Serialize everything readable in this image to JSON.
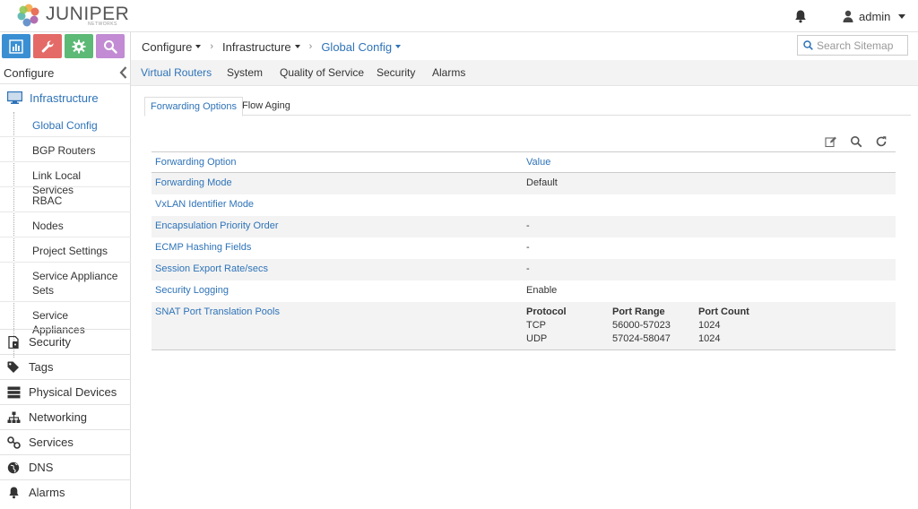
{
  "header": {
    "logo_text": "JUNIPER",
    "logo_sub": "NETWORKS",
    "user_name": "admin"
  },
  "sidebar": {
    "title": "Configure",
    "mode_tabs": [
      {
        "name": "monitor",
        "color": "#3a8fd3",
        "icon": "bar-chart-icon"
      },
      {
        "name": "configure",
        "color": "#e46a67",
        "icon": "wrench-icon"
      },
      {
        "name": "settings",
        "color": "#5cb976",
        "icon": "gear-icon"
      },
      {
        "name": "query",
        "color": "#c28bd3",
        "icon": "search-icon"
      }
    ],
    "infrastructure": {
      "label": "Infrastructure",
      "icon": "monitor-icon"
    },
    "sub_items": [
      {
        "label": "Global Config"
      },
      {
        "label": "BGP Routers"
      },
      {
        "label": "Link Local Services"
      },
      {
        "label": "RBAC"
      },
      {
        "label": "Nodes"
      },
      {
        "label": "Project Settings"
      },
      {
        "label": "Service Appliance Sets"
      },
      {
        "label": "Service Appliances"
      }
    ],
    "nav_items": [
      {
        "label": "Security",
        "icon": "security-doc-icon"
      },
      {
        "label": "Tags",
        "icon": "tags-icon"
      },
      {
        "label": "Physical Devices",
        "icon": "server-icon"
      },
      {
        "label": "Networking",
        "icon": "sitemap-icon"
      },
      {
        "label": "Services",
        "icon": "services-icon"
      },
      {
        "label": "DNS",
        "icon": "globe-icon"
      },
      {
        "label": "Alarms",
        "icon": "bell-icon"
      }
    ]
  },
  "breadcrumb": [
    {
      "label": "Configure"
    },
    {
      "label": "Infrastructure"
    },
    {
      "label": "Global Config"
    }
  ],
  "search": {
    "placeholder": "Search Sitemap"
  },
  "tabs": [
    {
      "label": "Virtual Routers"
    },
    {
      "label": "System"
    },
    {
      "label": "Quality of Service"
    },
    {
      "label": "Security"
    },
    {
      "label": "Alarms"
    }
  ],
  "subtabs": [
    {
      "label": "Forwarding Options"
    },
    {
      "label": "Flow Aging"
    }
  ],
  "grid": {
    "headers": {
      "option": "Forwarding Option",
      "value": "Value"
    },
    "rows": [
      {
        "option": "Forwarding Mode",
        "value": "Default"
      },
      {
        "option": "VxLAN Identifier Mode",
        "value": ""
      },
      {
        "option": "Encapsulation Priority Order",
        "value": "-"
      },
      {
        "option": "ECMP Hashing Fields",
        "value": "-"
      },
      {
        "option": "Session Export Rate/secs",
        "value": "-"
      },
      {
        "option": "Security Logging",
        "value": "Enable"
      }
    ],
    "snat": {
      "option": "SNAT Port Translation Pools",
      "columns": {
        "protocol": "Protocol",
        "port_range": "Port Range",
        "port_count": "Port Count"
      },
      "rows": [
        {
          "protocol": "TCP",
          "port_range": "56000-57023",
          "port_count": "1024"
        },
        {
          "protocol": "UDP",
          "port_range": "57024-58047",
          "port_count": "1024"
        }
      ]
    }
  },
  "colors": {
    "accent": "#2e73b8"
  }
}
